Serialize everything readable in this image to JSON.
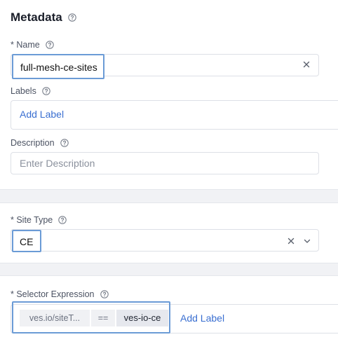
{
  "metadata": {
    "title": "Metadata",
    "name": {
      "label": "* Name",
      "value": "full-mesh-ce-sites"
    },
    "labels": {
      "label": "Labels",
      "add_label": "Add Label"
    },
    "description": {
      "label": "Description",
      "placeholder": "Enter Description"
    }
  },
  "site_type": {
    "label": "* Site Type",
    "value": "CE"
  },
  "selector": {
    "label": "* Selector Expression",
    "key": "ves.io/siteT...",
    "operator": "==",
    "value": "ves-io-ce",
    "add_label": "Add Label"
  },
  "colors": {
    "accent": "#3a6fd1",
    "highlight": "#6b9bd6",
    "divider": "#f1f2f5"
  },
  "icons": {
    "help": "question-circle-icon",
    "clear": "close-icon",
    "dropdown": "chevron-down-icon"
  }
}
